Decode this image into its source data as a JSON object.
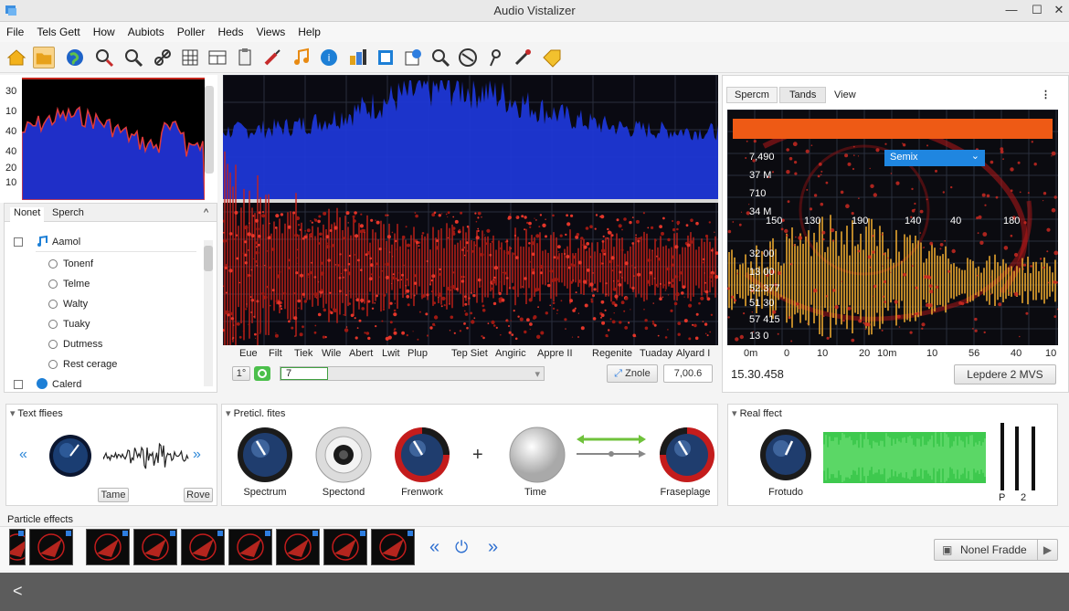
{
  "window": {
    "title": "Audio Vistalizer",
    "min": "—",
    "max": "☐",
    "close": "✕"
  },
  "menu": [
    "File",
    "Tels Gett",
    "How",
    "Aubiots",
    "Poller",
    "Heds",
    "Views",
    "Help"
  ],
  "toolbar_icons": [
    "home-icon",
    "folder-icon",
    "globe-icon",
    "search-icon",
    "zoom-icon",
    "link-icon",
    "grid-icon",
    "layout-icon",
    "clipboard-icon",
    "brush-icon",
    "music-note-icon",
    "globe-info-icon",
    "palette-icon",
    "frame-icon",
    "share-icon",
    "magnify-icon",
    "disc-icon",
    "pin-icon",
    "pen-icon",
    "tag-icon"
  ],
  "mini_chart": {
    "y_ticks": [
      "30",
      "10",
      "40",
      "40",
      "20",
      "10"
    ]
  },
  "left_tabs": {
    "tab1": "Nonet",
    "tab2": "Sperch",
    "collapse": "^"
  },
  "tree": {
    "root1": "Aamol",
    "children": [
      "Tonenf",
      "Telme",
      "Walty",
      "Tuaky",
      "Dutmess",
      "Rest cerage"
    ],
    "root2": "Calerd"
  },
  "center_axis_labels": [
    "Eue",
    "Filt",
    "Tiek",
    "Wile",
    "Abert",
    "Lwit",
    "Plup",
    "Tep Siet",
    "Angiric",
    "Appre II",
    "Regenite",
    "Tuaday",
    "Alyard I"
  ],
  "transport": {
    "speed": "1°",
    "field_value": "7",
    "zoom_label": "Znole",
    "value_box": "7,00.6",
    "scroll_arrow": "▾"
  },
  "right_tabs": {
    "tab1": "Spercm",
    "tab2": "Tands",
    "tab3": "View",
    "more": "⋮"
  },
  "right_dropdown": {
    "value": "Semix",
    "arrow": "⌄"
  },
  "right_y_labels": [
    "7,490",
    "37 M",
    "710",
    "34 M",
    "32 00",
    "13 00",
    "52.377",
    "51 30",
    "57 415",
    "13 0"
  ],
  "right_x_labels": [
    "0m",
    "0",
    "10",
    "20",
    "10m",
    "10",
    "56",
    "40",
    "10"
  ],
  "right_top_labels": [
    "150",
    "130",
    "190",
    "140",
    "40",
    "180"
  ],
  "right_readout": "15.30.458",
  "right_button": "Lepdere 2 MVS",
  "text_effects": {
    "header": "Text ffiees",
    "btn1": "Tame",
    "btn2": "Rove",
    "left_arrows": "«",
    "right_arrows": "»"
  },
  "particle_fx_panel": {
    "header": "Preticl. fites",
    "knobs": [
      "Spectrum",
      "Spectond",
      "Frenwork",
      "Time",
      "Fraseplage"
    ],
    "plus": "+"
  },
  "real_effect": {
    "header": "Real ffect",
    "knob": "Frotudo",
    "fader1": "P",
    "fader2": "2"
  },
  "particle_effects": {
    "header": "Particle effects",
    "prev": "«",
    "power": "⏻",
    "next": "»",
    "select_value": "Nonel Fradde",
    "play": "▶"
  },
  "colors": {
    "accent_blue": "#1e4fd0",
    "accent_red": "#d4261c",
    "wave_orange": "#e7a62e",
    "green_wave": "#45d15a",
    "dropdown_blue": "#1f86e0"
  },
  "back": "<"
}
